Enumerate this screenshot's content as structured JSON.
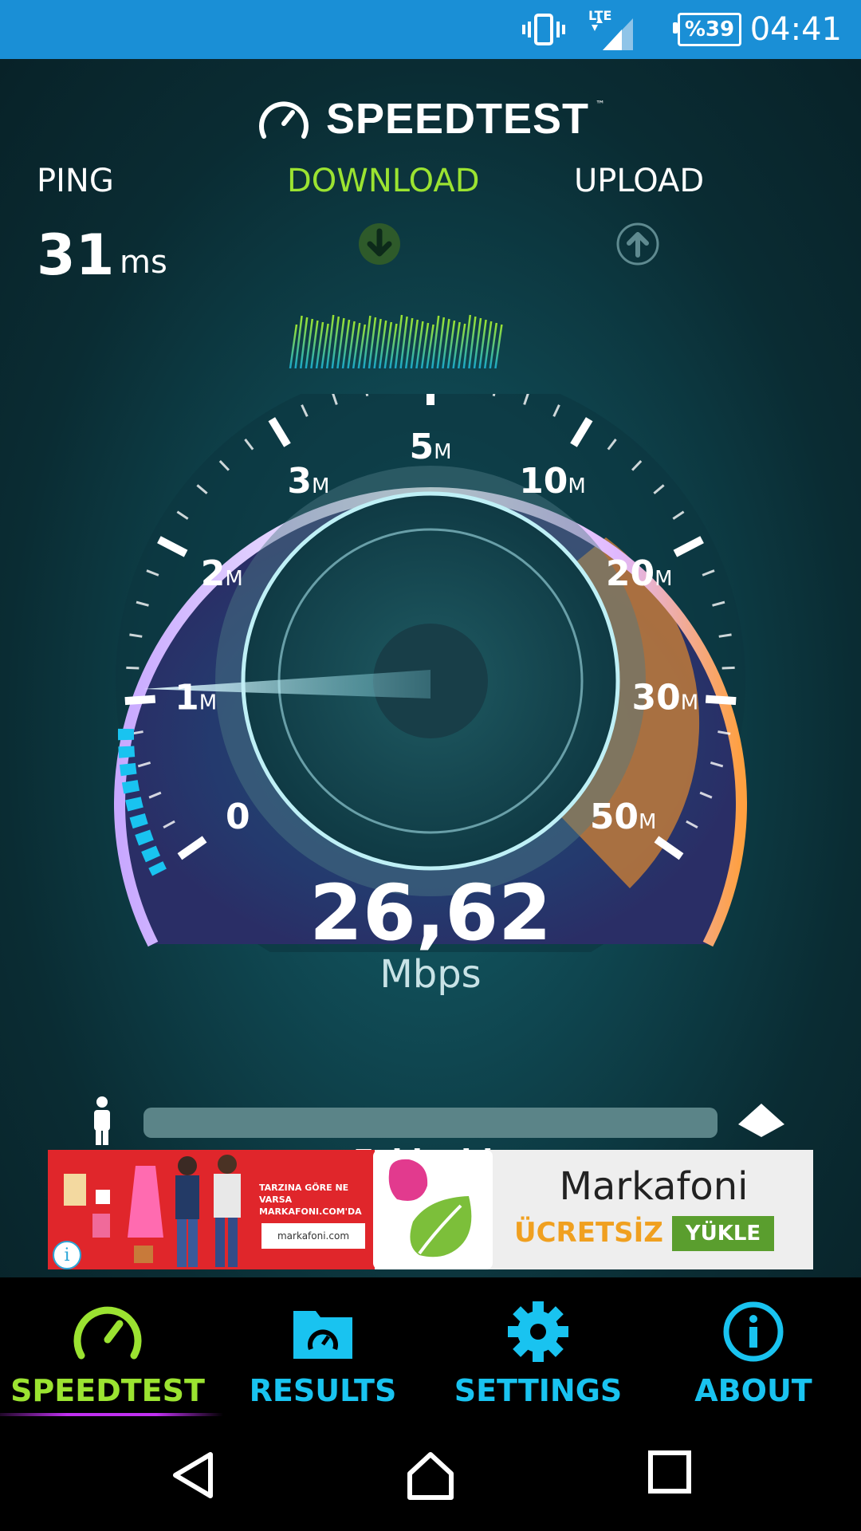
{
  "status_bar": {
    "time": "04:41",
    "battery": "%39",
    "network": "LTE",
    "icons": [
      "vibrate-icon",
      "signal-icon",
      "battery-icon"
    ]
  },
  "app": {
    "logo_text": "SPEEDTEST",
    "logo_tm": "™"
  },
  "metrics": {
    "ping_label": "PING",
    "ping_value": "31",
    "ping_unit": "ms",
    "download_label": "DOWNLOAD",
    "upload_label": "UPLOAD"
  },
  "gauge": {
    "ticks": [
      {
        "value": "0",
        "unit": ""
      },
      {
        "value": "1",
        "unit": "M"
      },
      {
        "value": "2",
        "unit": "M"
      },
      {
        "value": "3",
        "unit": "M"
      },
      {
        "value": "5",
        "unit": "M"
      },
      {
        "value": "10",
        "unit": "M"
      },
      {
        "value": "20",
        "unit": "M"
      },
      {
        "value": "30",
        "unit": "M"
      },
      {
        "value": "50",
        "unit": "M"
      }
    ],
    "speed_value": "26,62",
    "speed_unit": "Mbps",
    "colors": {
      "accent": "#9be331",
      "ring": "#b58cff",
      "high": "#f08a2a",
      "low": "#19c3f0"
    }
  },
  "server": {
    "name": "Eskisehir"
  },
  "ad": {
    "tagline": "TARZINA GÖRE NE VARSA MARKAFONI.COM'DA",
    "brand_logo": "markafoni.com",
    "title": "Markafoni",
    "free_label": "ÜCRETSİZ",
    "install_label": "YÜKLE",
    "info_icon": "i"
  },
  "tabs": [
    {
      "label": "SPEEDTEST",
      "icon": "speedometer-icon",
      "active": true
    },
    {
      "label": "RESULTS",
      "icon": "results-folder-icon",
      "active": false
    },
    {
      "label": "SETTINGS",
      "icon": "gear-icon",
      "active": false
    },
    {
      "label": "ABOUT",
      "icon": "info-icon",
      "active": false
    }
  ],
  "nav": [
    "back-icon",
    "home-icon",
    "recents-icon"
  ]
}
